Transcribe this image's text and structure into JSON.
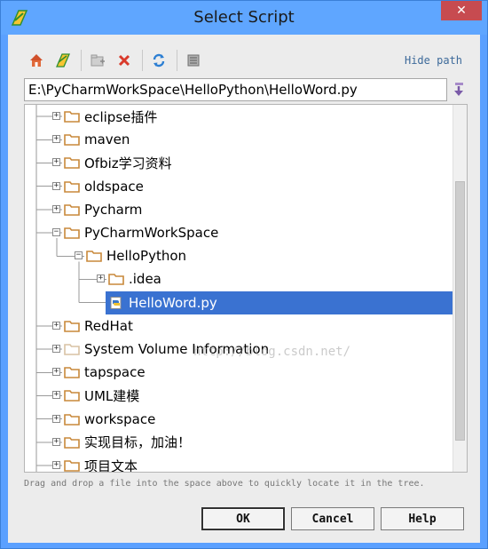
{
  "window": {
    "title": "Select Script",
    "close_label": "✕"
  },
  "toolbar": {
    "buttons": [
      {
        "icon": "home-icon"
      },
      {
        "icon": "project-icon"
      },
      {
        "icon": "new-folder-icon"
      },
      {
        "icon": "delete-icon"
      },
      {
        "icon": "refresh-icon"
      },
      {
        "icon": "show-hidden-icon"
      }
    ],
    "hide_path_label": "Hide path"
  },
  "path_field": {
    "value": "E:\\PyCharmWorkSpace\\HelloPython\\HelloWord.py"
  },
  "tree": {
    "items": [
      {
        "label": "eclipse插件",
        "level": 0,
        "expander": "+",
        "type": "folder"
      },
      {
        "label": "maven",
        "level": 0,
        "expander": "+",
        "type": "folder"
      },
      {
        "label": "Ofbiz学习资料",
        "level": 0,
        "expander": "+",
        "type": "folder"
      },
      {
        "label": "oldspace",
        "level": 0,
        "expander": "+",
        "type": "folder"
      },
      {
        "label": "Pycharm",
        "level": 0,
        "expander": "+",
        "type": "folder"
      },
      {
        "label": "PyCharmWorkSpace",
        "level": 0,
        "expander": "−",
        "type": "folder"
      },
      {
        "label": "HelloPython",
        "level": 1,
        "expander": "−",
        "type": "folder"
      },
      {
        "label": ".idea",
        "level": 2,
        "expander": "+",
        "type": "folder"
      },
      {
        "label": "HelloWord.py",
        "level": 2,
        "expander": "",
        "type": "python-file",
        "selected": true
      },
      {
        "label": "RedHat",
        "level": 0,
        "expander": "+",
        "type": "folder"
      },
      {
        "label": "System Volume Information",
        "level": 0,
        "expander": "+",
        "type": "folder-disabled"
      },
      {
        "label": "tapspace",
        "level": 0,
        "expander": "+",
        "type": "folder"
      },
      {
        "label": "UML建模",
        "level": 0,
        "expander": "+",
        "type": "folder"
      },
      {
        "label": "workspace",
        "level": 0,
        "expander": "+",
        "type": "folder"
      },
      {
        "label": "实现目标，加油！",
        "level": 0,
        "expander": "+",
        "type": "folder"
      },
      {
        "label": "项目文本",
        "level": 0,
        "expander": "+",
        "type": "folder"
      }
    ],
    "watermark": "http://blog.csdn.net/"
  },
  "hint": "Drag and drop a file into the space above to quickly locate it in the tree.",
  "buttons": {
    "ok": "OK",
    "cancel": "Cancel",
    "help": "Help"
  },
  "colors": {
    "titlebar": "#5fa6ff",
    "selection": "#3a72d1",
    "close": "#c74b50",
    "folder": "#c8883a"
  }
}
